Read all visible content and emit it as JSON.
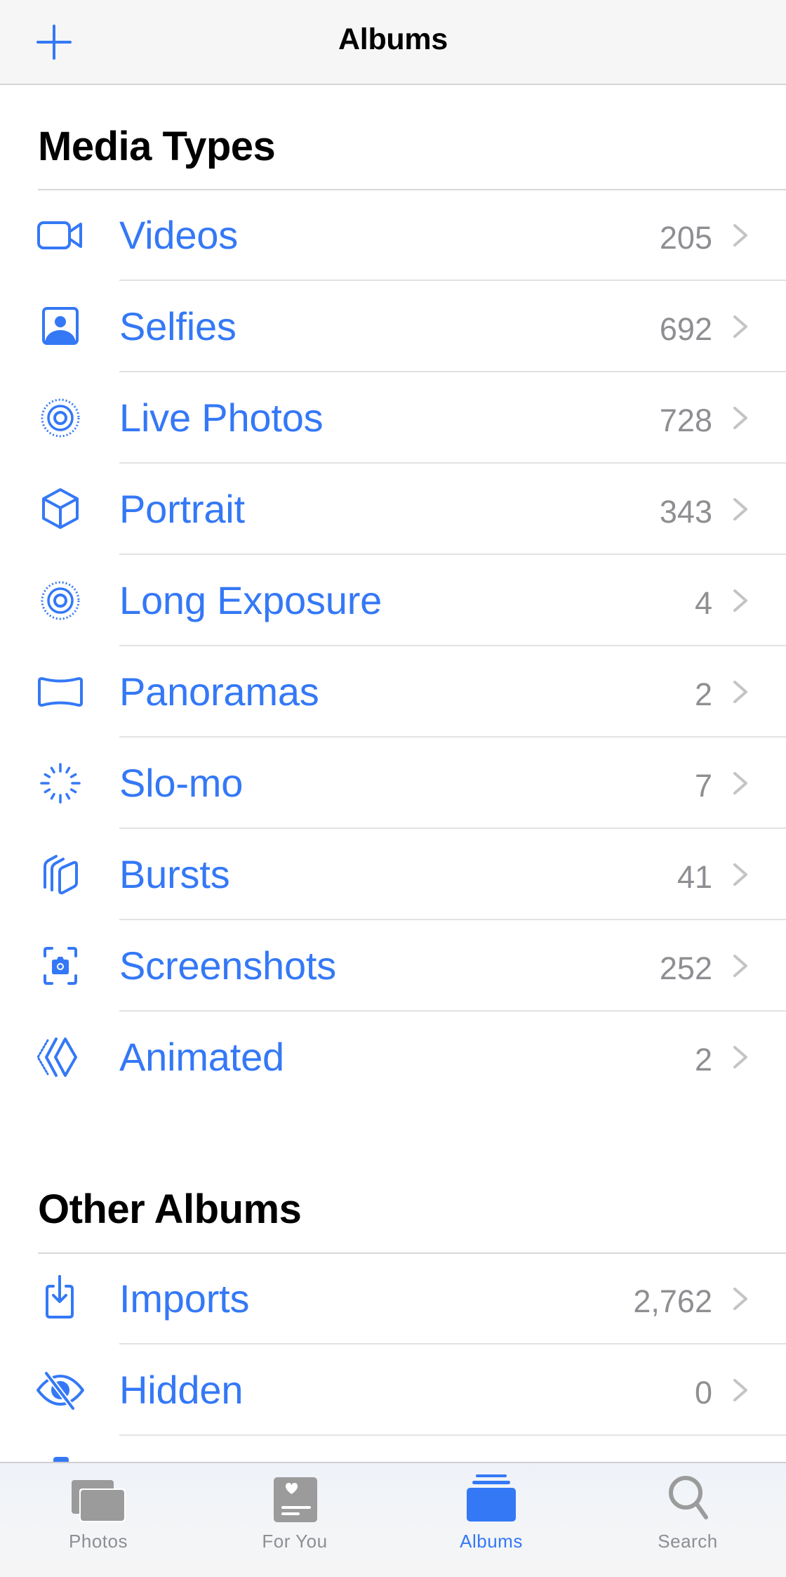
{
  "nav": {
    "title": "Albums",
    "add_icon": "plus-icon"
  },
  "colors": {
    "accent": "#3478f6",
    "count_gray": "#8e8e93",
    "chevron_gray": "#c4c4c7",
    "tab_inactive": "#9b9b9b"
  },
  "sections": [
    {
      "title": "Media Types",
      "items": [
        {
          "label": "Videos",
          "count": "205",
          "icon": "video-camera-icon"
        },
        {
          "label": "Selfies",
          "count": "692",
          "icon": "selfie-person-icon"
        },
        {
          "label": "Live Photos",
          "count": "728",
          "icon": "live-photo-icon"
        },
        {
          "label": "Portrait",
          "count": "343",
          "icon": "cube-icon"
        },
        {
          "label": "Long Exposure",
          "count": "4",
          "icon": "long-exposure-icon"
        },
        {
          "label": "Panoramas",
          "count": "2",
          "icon": "panorama-icon"
        },
        {
          "label": "Slo-mo",
          "count": "7",
          "icon": "slo-mo-icon"
        },
        {
          "label": "Bursts",
          "count": "41",
          "icon": "bursts-icon"
        },
        {
          "label": "Screenshots",
          "count": "252",
          "icon": "screenshot-camera-icon"
        },
        {
          "label": "Animated",
          "count": "2",
          "icon": "animated-icon"
        }
      ]
    },
    {
      "title": "Other Albums",
      "items": [
        {
          "label": "Imports",
          "count": "2,762",
          "icon": "import-tray-icon"
        },
        {
          "label": "Hidden",
          "count": "0",
          "icon": "eye-slash-icon"
        }
      ]
    }
  ],
  "tabbar": {
    "active": "Albums",
    "tabs": [
      {
        "label": "Photos",
        "icon": "photos-stack-icon"
      },
      {
        "label": "For You",
        "icon": "for-you-heart-card-icon"
      },
      {
        "label": "Albums",
        "icon": "albums-folder-icon"
      },
      {
        "label": "Search",
        "icon": "magnifying-glass-icon"
      }
    ]
  }
}
